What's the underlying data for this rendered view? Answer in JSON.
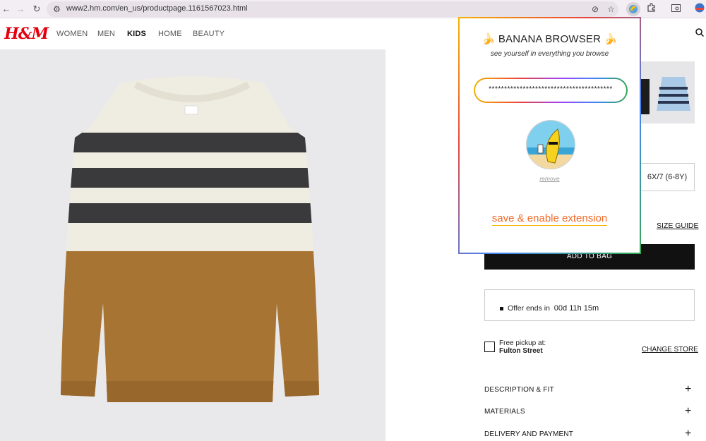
{
  "browser": {
    "url": "www2.hm.com/en_us/productpage.1161567023.html",
    "icons": [
      "back-icon",
      "forward-icon",
      "reload-icon",
      "site-settings-icon",
      "eye-slash-icon",
      "star-icon",
      "extension-banana-icon",
      "puzzle-icon",
      "tab-search-icon",
      "profile-icon"
    ]
  },
  "site": {
    "logo": "H&M",
    "nav": [
      "WOMEN",
      "MEN",
      "KIDS",
      "HOME",
      "BEAUTY"
    ],
    "active_nav": "KIDS",
    "brand_color": "#e50010"
  },
  "product": {
    "size_option": "6X/7 (6-8Y)",
    "size_guide": "SIZE GUIDE",
    "add_to_bag": "ADD TO BAG",
    "offer_label": "Offer ends in",
    "offer_time": "00d 11h 15m",
    "pickup_label": "Free pickup at:",
    "pickup_store": "Fulton Street",
    "change_store": "CHANGE STORE",
    "accordions": [
      "DESCRIPTION & FIT",
      "MATERIALS",
      "DELIVERY AND PAYMENT"
    ]
  },
  "extension": {
    "title": "BANANA BROWSER",
    "title_emoji": "🍌",
    "subtitle": "see yourself in everything you browse",
    "password_value": "****************************************",
    "remove_label": "remove",
    "save_label": "save & enable extension",
    "accent": "#ef6b2a"
  }
}
